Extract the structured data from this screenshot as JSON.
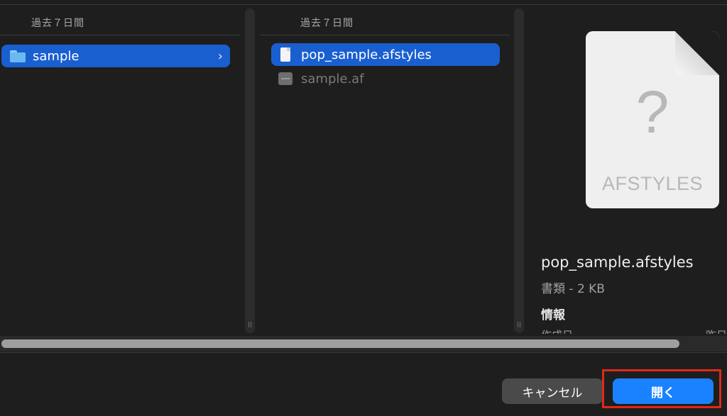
{
  "browser": {
    "column1": {
      "header": "過去７日間",
      "items": [
        {
          "label": "sample",
          "icon": "folder-icon",
          "selected": true,
          "chevron": "›"
        }
      ]
    },
    "column2": {
      "header": "過去７日間",
      "items": [
        {
          "label": "pop_sample.afstyles",
          "icon": "document-icon",
          "selected": true
        },
        {
          "label": "sample.af",
          "icon": "app-file-icon",
          "selected": false,
          "dimmed": true
        }
      ]
    }
  },
  "preview": {
    "icon_symbol": "?",
    "icon_extension": "AFSTYLES",
    "file_name": "pop_sample.afstyles",
    "kind_size": "書類 - 2 KB",
    "info_heading": "情報",
    "created_label": "作成日",
    "created_value": "昨日"
  },
  "footer": {
    "cancel_label": "キャンセル",
    "open_label": "開く"
  },
  "colors": {
    "background": "#1e1e1e",
    "selection": "#1a5fd0",
    "primary_button": "#1a82ff",
    "highlight_box": "#e0281b"
  }
}
